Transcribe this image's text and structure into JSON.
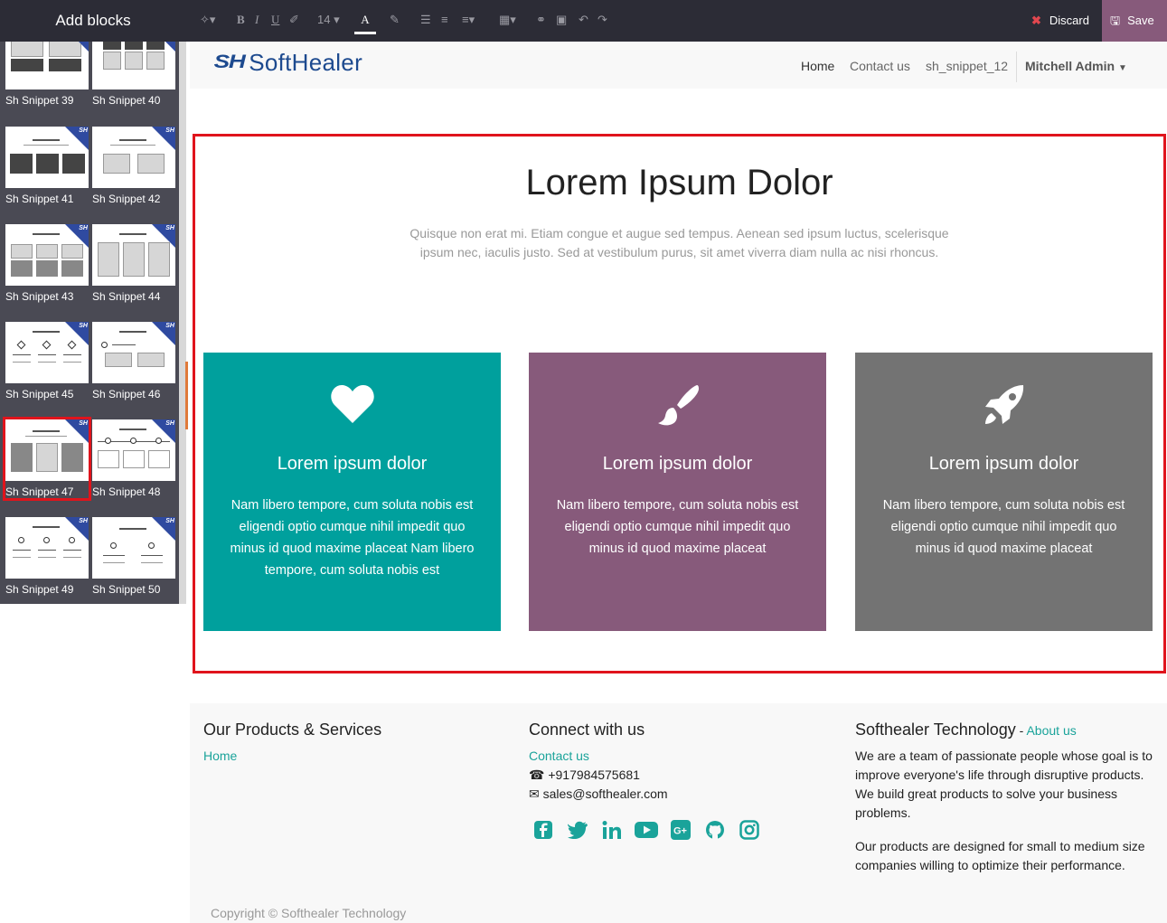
{
  "sidebar": {
    "title": "Add blocks",
    "snippets": [
      {
        "label": "Sh Snippet 39"
      },
      {
        "label": "Sh Snippet 40"
      },
      {
        "label": "Sh Snippet 41"
      },
      {
        "label": "Sh Snippet 42"
      },
      {
        "label": "Sh Snippet 43"
      },
      {
        "label": "Sh Snippet 44"
      },
      {
        "label": "Sh Snippet 45"
      },
      {
        "label": "Sh Snippet 46"
      },
      {
        "label": "Sh Snippet 47"
      },
      {
        "label": "Sh Snippet 48"
      },
      {
        "label": "Sh Snippet 49"
      },
      {
        "label": "Sh Snippet 50"
      }
    ],
    "selected": "Sh Snippet 47",
    "badge": "SH"
  },
  "toolbar": {
    "font_size": "14",
    "text_color_label": "A",
    "discard_label": "Discard",
    "save_label": "Save"
  },
  "navbar": {
    "logo_mark": "SH",
    "logo_text": "SoftHealer",
    "items": [
      "Home",
      "Contact us",
      "sh_snippet_12"
    ],
    "active": "Home",
    "user": "Mitchell Admin"
  },
  "hero": {
    "title": "Lorem Ipsum Dolor",
    "subtitle": "Quisque non erat mi. Etiam congue et augue sed tempus. Aenean sed ipsum luctus, scelerisque ipsum nec, iaculis justo. Sed at vestibulum purus, sit amet viverra diam nulla ac nisi rhoncus."
  },
  "cards": [
    {
      "icon": "heart-icon",
      "title": "Lorem ipsum dolor",
      "text": "Nam libero tempore, cum soluta nobis est eligendi optio cumque nihil impedit quo minus id quod maxime placeat Nam libero tempore, cum soluta nobis est",
      "color": "#00a09d"
    },
    {
      "icon": "paint-brush-icon",
      "title": "Lorem ipsum dolor",
      "text": "Nam libero tempore, cum soluta nobis est eligendi optio cumque nihil impedit quo minus id quod maxime placeat",
      "color": "#875a7b"
    },
    {
      "icon": "rocket-icon",
      "title": "Lorem ipsum dolor",
      "text": "Nam libero tempore, cum soluta nobis est eligendi optio cumque nihil impedit quo minus id quod maxime placeat",
      "color": "#737373"
    }
  ],
  "footer": {
    "products_title": "Our Products & Services",
    "products_link": "Home",
    "connect_title": "Connect with us",
    "contact_link": "Contact us",
    "phone": "+917984575681",
    "email": "sales@softhealer.com",
    "social_icons": [
      "facebook-icon",
      "twitter-icon",
      "linkedin-icon",
      "youtube-icon",
      "google-plus-icon",
      "github-icon",
      "instagram-icon"
    ],
    "company_title": "Softhealer Technology",
    "company_sep": " - ",
    "about_link": "About us",
    "about_p1": "We are a team of passionate people whose goal is to improve everyone's life through disruptive products. We build great products to solve your business problems.",
    "about_p2": "Our products are designed for small to medium size companies willing to optimize their performance.",
    "copyright": "Copyright © Softhealer Technology"
  },
  "colors": {
    "accent": "#00a09d",
    "brand": "#875a7b",
    "selection": "#e0141c"
  }
}
